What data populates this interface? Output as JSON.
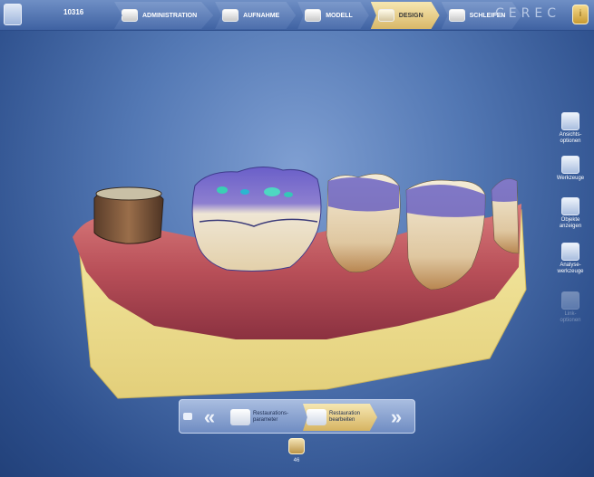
{
  "header": {
    "case_id": "10316",
    "steps": [
      {
        "label": "Administration",
        "state": "normal"
      },
      {
        "label": "Aufnahme",
        "state": "normal"
      },
      {
        "label": "Modell",
        "state": "normal"
      },
      {
        "label": "Design",
        "state": "active"
      },
      {
        "label": "Schleifen",
        "state": "normal"
      }
    ],
    "brand": "CEREC",
    "brand_icon": "info-icon"
  },
  "right_tools": [
    {
      "label_lines": [
        "Ansichts-",
        "optionen"
      ],
      "icon": "cube-icon",
      "enabled": true
    },
    {
      "label_lines": [
        "Werkzeuge"
      ],
      "icon": "tool-ring-icon",
      "enabled": true
    },
    {
      "label_lines": [
        "Objekte",
        "anzeigen"
      ],
      "icon": "object-icon",
      "enabled": true
    },
    {
      "label_lines": [
        "Analyse-",
        "werkzeuge"
      ],
      "icon": "analysis-icon",
      "enabled": true
    },
    {
      "label_lines": [
        "Link-",
        "optionen"
      ],
      "icon": "link-icon",
      "enabled": false
    }
  ],
  "bottom_bar": {
    "buttons": [
      {
        "label_lines": [
          "Restaurations-",
          "parameter"
        ],
        "icon": "tooth-icon",
        "state": "normal"
      },
      {
        "label_lines": [
          "Restauration",
          "bearbeiten"
        ],
        "icon": "tooth-icon",
        "state": "active"
      }
    ],
    "tooth_number": "46"
  },
  "colors": {
    "accent_active": "#d9b868",
    "background": "#5378b4"
  }
}
